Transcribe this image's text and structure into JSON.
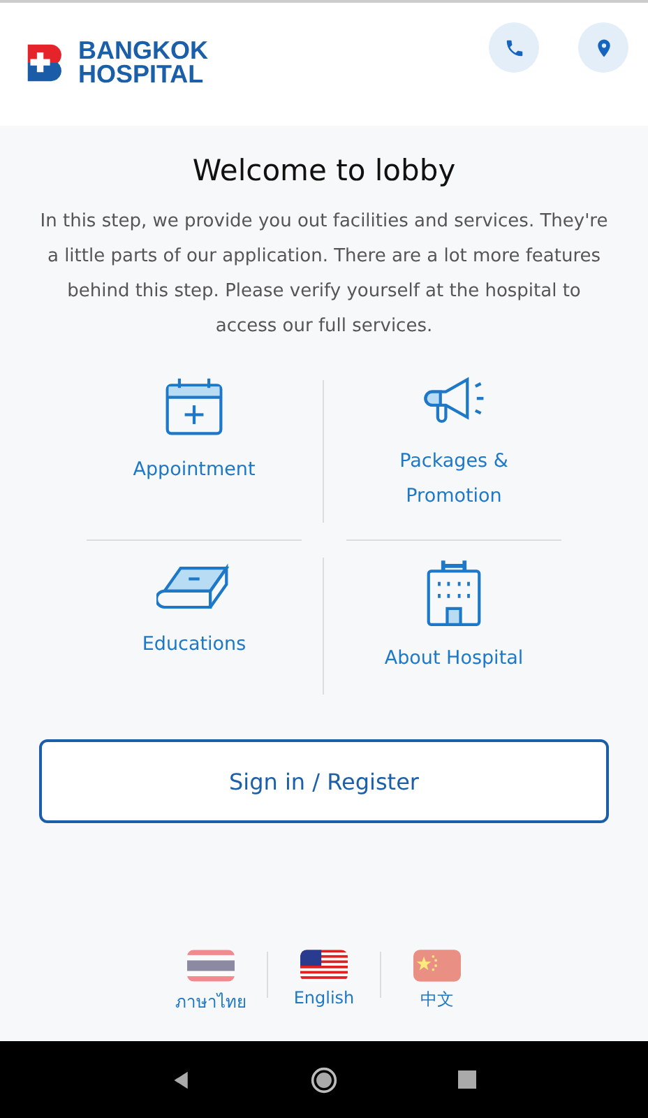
{
  "header": {
    "logo_line_1": "BANGKOK",
    "logo_line_2": "HOSPITAL"
  },
  "title": "Welcome to lobby",
  "intro": "In this step, we provide you out facilities and services. They're a little parts of our application. There are a lot more features behind this step. Please verify yourself at the hospital to access our full services.",
  "menu": [
    {
      "kind": "calendar",
      "label": "Appointment"
    },
    {
      "kind": "megaphone",
      "label": "Packages & Promotion"
    },
    {
      "kind": "book",
      "label": "Educations"
    },
    {
      "kind": "building",
      "label": "About Hospital"
    }
  ],
  "sign_in_button": "Sign in / Register",
  "languages": [
    {
      "kind": "thai",
      "label": "ภาษาไทย",
      "selected": false
    },
    {
      "kind": "us",
      "label": "English",
      "selected": true
    },
    {
      "kind": "china",
      "label": "中文",
      "selected": false
    }
  ]
}
